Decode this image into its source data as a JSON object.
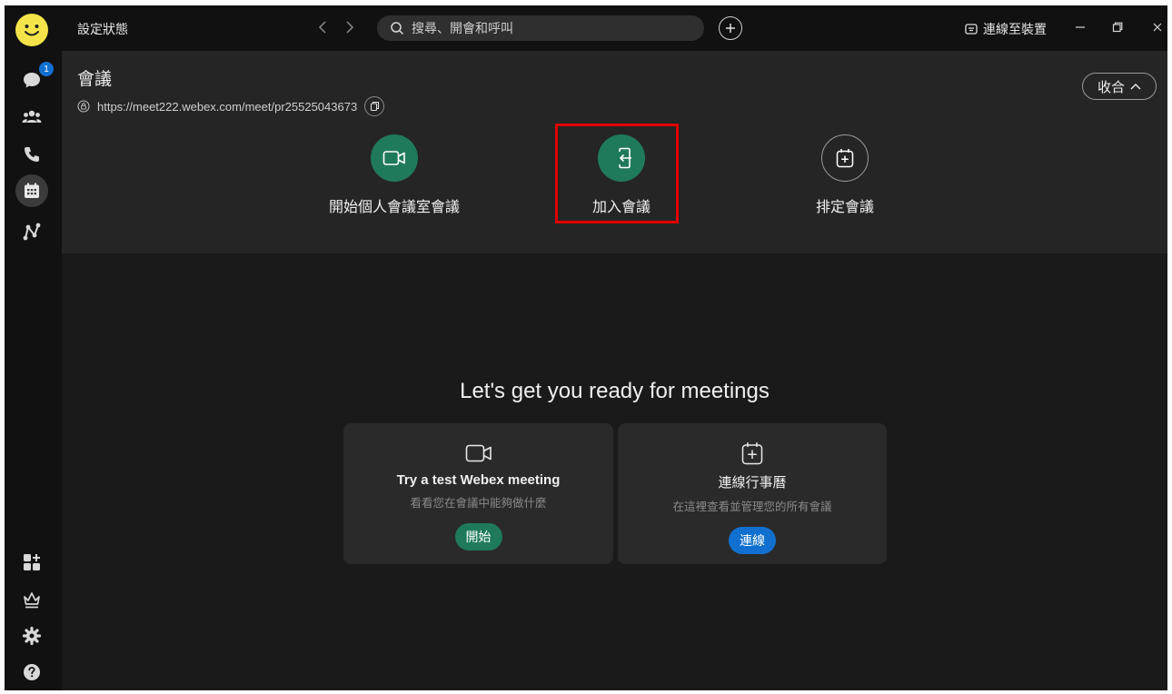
{
  "titlebar": {
    "status": "設定狀態",
    "search_placeholder": "搜尋、開會和呼叫",
    "connect_device": "連線至裝置"
  },
  "sidebar": {
    "messaging_badge": "1",
    "items": [
      "messaging-icon",
      "teams-icon",
      "calling-icon",
      "meetings-icon",
      "analytics-icon"
    ],
    "bottom_items": [
      "apps-icon",
      "crown-icon",
      "settings-icon",
      "help-icon"
    ]
  },
  "header": {
    "title": "會議",
    "url": "https://meet222.webex.com/meet/pr25525043673",
    "collapse_label": "收合"
  },
  "actions": {
    "start_personal": "開始個人會議室會議",
    "join": "加入會議",
    "schedule": "排定會議"
  },
  "main": {
    "title": "Let's get you ready for meetings",
    "cards": [
      {
        "title": "Try a test Webex meeting",
        "subtitle": "看看您在會議中能夠做什麼",
        "button": "開始"
      },
      {
        "title": "連線行事曆",
        "subtitle": "在這裡查看並管理您的所有會議",
        "button": "連線"
      }
    ]
  },
  "colors": {
    "accent_green": "#1f7a5b",
    "accent_blue": "#1170cf",
    "highlight_red": "#e10000",
    "avatar_yellow": "#f4e44a"
  }
}
